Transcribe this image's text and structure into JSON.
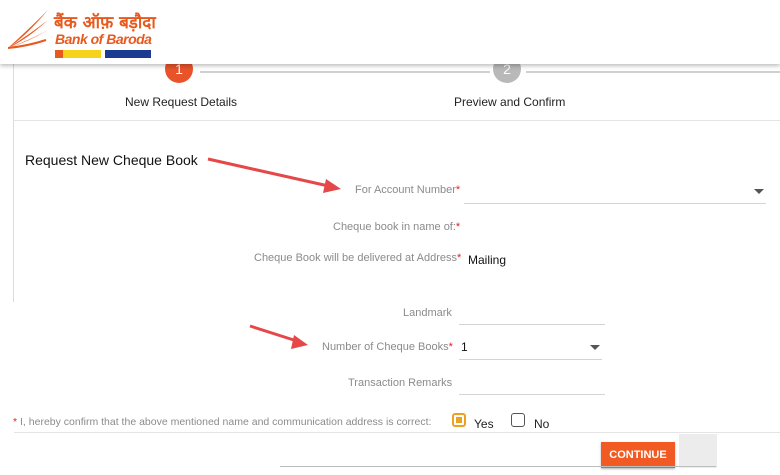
{
  "brand": {
    "name_hindi": "बैंक ऑफ़ बड़ौदा",
    "name_english": "Bank of Baroda",
    "colors": {
      "primary": "#e8591e",
      "accent": "#f15a22"
    }
  },
  "stepper": {
    "steps": [
      {
        "number": "1",
        "label": "New Request Details",
        "status": "active"
      },
      {
        "number": "2",
        "label": "Preview and Confirm",
        "status": "pending"
      }
    ]
  },
  "form": {
    "title": "Request New Cheque Book",
    "account_number": {
      "label": "For Account Number",
      "value": ""
    },
    "cheque_name": {
      "label": "Cheque book in name of:",
      "value": ""
    },
    "delivery_address": {
      "label": "Cheque Book will be delivered at Address",
      "value": "Mailing"
    },
    "landmark": {
      "label": "Landmark",
      "value": ""
    },
    "num_books": {
      "label": "Number of Cheque Books",
      "value": "1"
    },
    "remarks": {
      "label": "Transaction Remarks",
      "value": ""
    },
    "required_mark": "*"
  },
  "confirmation": {
    "text": "I, hereby confirm that the above mentioned name and communication address is correct:",
    "yes_label": "Yes",
    "no_label": "No",
    "selected": "yes"
  },
  "actions": {
    "continue_label": "CONTINUE"
  }
}
